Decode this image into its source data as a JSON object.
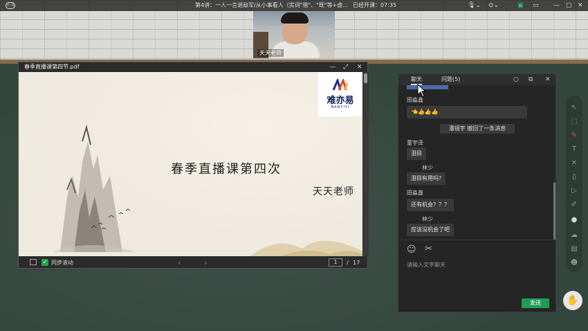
{
  "topbar": {
    "live_icon": "broadcast-icon",
    "title": "第4讲：一人一言退敌军/从小事看人（实词\"借\"、\"既\"等+虚...",
    "elapsed": "已经开课：07:35",
    "controls": [
      "microphone-icon",
      "camera-icon",
      "screen-icon",
      "more-icon"
    ]
  },
  "video": {
    "name": "天天老师"
  },
  "pdf": {
    "title": "春季直播课第四节.pdf",
    "slide_title": "春季直播课第四次",
    "slide_teacher": "天天老师",
    "logo_brand": "难亦易",
    "logo_sub": "NANYIYI",
    "sync_label": "同步滚动",
    "page_current": "1",
    "page_sep": "/",
    "page_total": "17"
  },
  "chat": {
    "tabs": [
      {
        "label": "聊天"
      },
      {
        "label": "问题(5)"
      }
    ],
    "messages": [
      {
        "name": "田淼鑫",
        "text": "👈👍👍👍"
      },
      {
        "system": "潘镜宇 撤回了一条消息"
      },
      {
        "name": "董宇泽",
        "text": "泪目"
      },
      {
        "name": "林少",
        "text": "泪目有用吗?"
      },
      {
        "name": "田淼鑫",
        "text": "还有机会？？？"
      },
      {
        "name": "林少",
        "text": "应该没机会了吧"
      }
    ],
    "input_placeholder": "请输入文字聊天",
    "send_label": "发送"
  },
  "colors": {
    "board": "#34473f",
    "send_button": "#1f9d55",
    "sync_check": "#28a745"
  }
}
